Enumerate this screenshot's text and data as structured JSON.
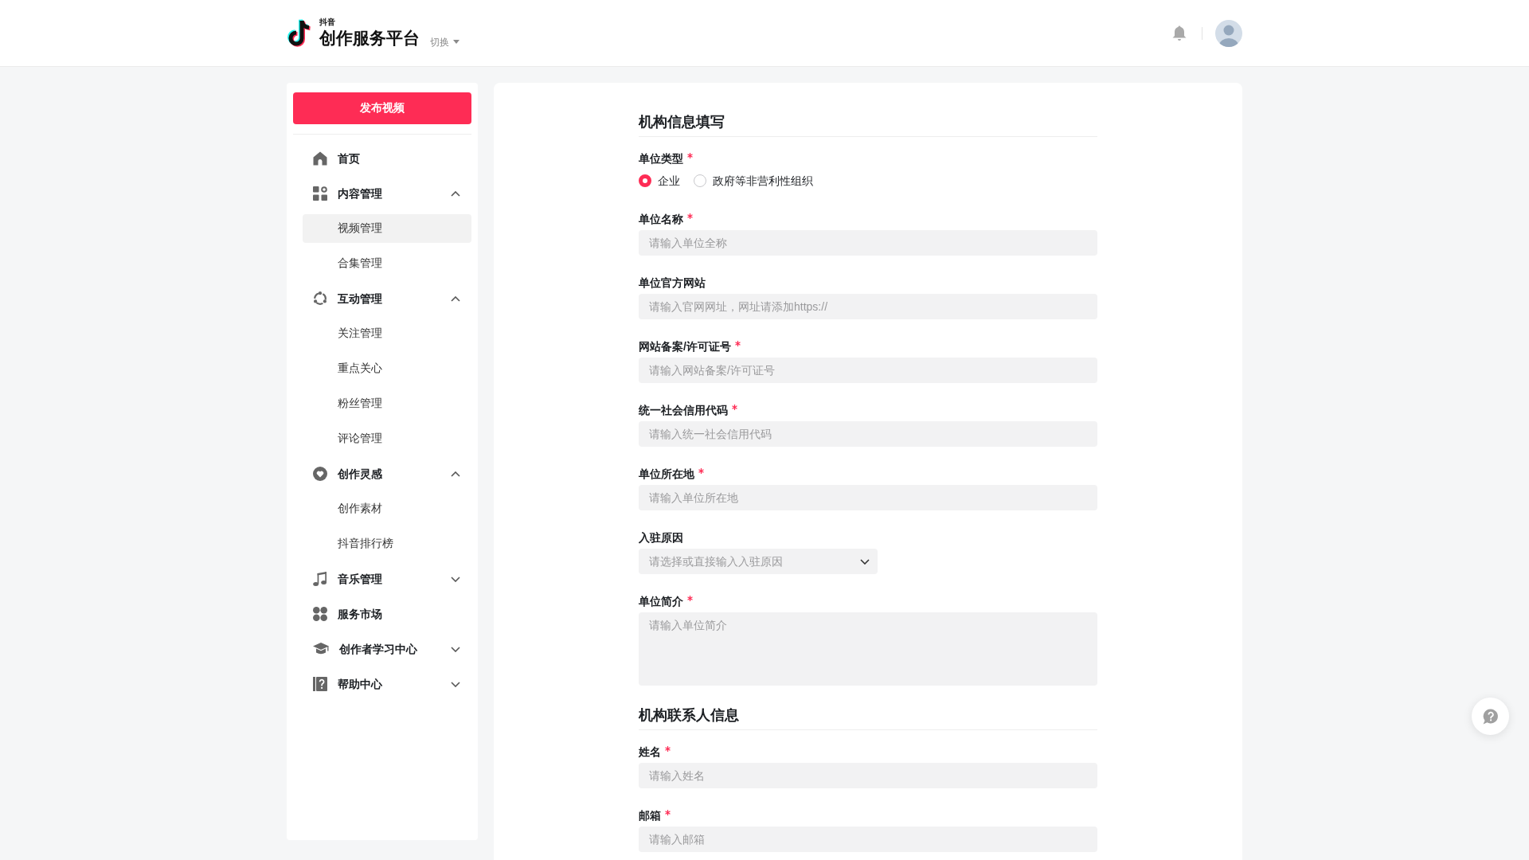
{
  "header": {
    "brand_small": "抖音",
    "brand": "创作服务平台",
    "switch": "切换"
  },
  "sidebar": {
    "publish_button": "发布视频",
    "menu": [
      {
        "label": "首页",
        "selected": false
      },
      {
        "label": "内容管理",
        "selected": false,
        "expanded": true,
        "children": [
          {
            "label": "视频管理",
            "selected": true
          },
          {
            "label": "合集管理",
            "selected": false
          }
        ]
      },
      {
        "label": "互动管理",
        "selected": false,
        "expanded": true,
        "children": [
          {
            "label": "关注管理",
            "selected": false
          },
          {
            "label": "重点关心",
            "selected": false
          },
          {
            "label": "粉丝管理",
            "selected": false
          },
          {
            "label": "评论管理",
            "selected": false
          }
        ]
      },
      {
        "label": "创作灵感",
        "selected": false,
        "expanded": true,
        "children": [
          {
            "label": "创作素材",
            "selected": false
          },
          {
            "label": "抖音排行榜",
            "selected": false
          }
        ]
      },
      {
        "label": "音乐管理",
        "selected": false,
        "expanded": false
      },
      {
        "label": "服务市场",
        "selected": false
      },
      {
        "label": "创作者学习中心",
        "selected": false,
        "expanded": false
      },
      {
        "label": "帮助中心",
        "selected": false,
        "expanded": false
      }
    ]
  },
  "form": {
    "sections": [
      {
        "title": "机构信息填写",
        "fields": [
          {
            "kind": "radio",
            "label": "单位类型",
            "required": true,
            "options": [
              {
                "label": "企业",
                "selected": true
              },
              {
                "label": "政府等非营利性组织",
                "selected": false
              }
            ]
          },
          {
            "kind": "text",
            "label": "单位名称",
            "required": true,
            "placeholder": "请输入单位全称"
          },
          {
            "kind": "text",
            "label": "单位官方网站",
            "required": false,
            "placeholder": "请输入官网网址，网址请添加https://"
          },
          {
            "kind": "text",
            "label": "网站备案/许可证号",
            "required": true,
            "placeholder": "请输入网站备案/许可证号"
          },
          {
            "kind": "text",
            "label": "统一社会信用代码",
            "required": true,
            "placeholder": "请输入统一社会信用代码"
          },
          {
            "kind": "text",
            "label": "单位所在地",
            "required": true,
            "placeholder": "请输入单位所在地"
          },
          {
            "kind": "select",
            "label": "入驻原因",
            "required": false,
            "placeholder": "请选择或直接输入入驻原因"
          },
          {
            "kind": "textarea",
            "label": "单位简介",
            "required": true,
            "placeholder": "请输入单位简介"
          }
        ]
      },
      {
        "title": "机构联系人信息",
        "fields": [
          {
            "kind": "text",
            "label": "姓名",
            "required": true,
            "placeholder": "请输入姓名"
          },
          {
            "kind": "text",
            "label": "邮箱",
            "required": true,
            "placeholder": "请输入邮箱"
          }
        ]
      }
    ]
  }
}
